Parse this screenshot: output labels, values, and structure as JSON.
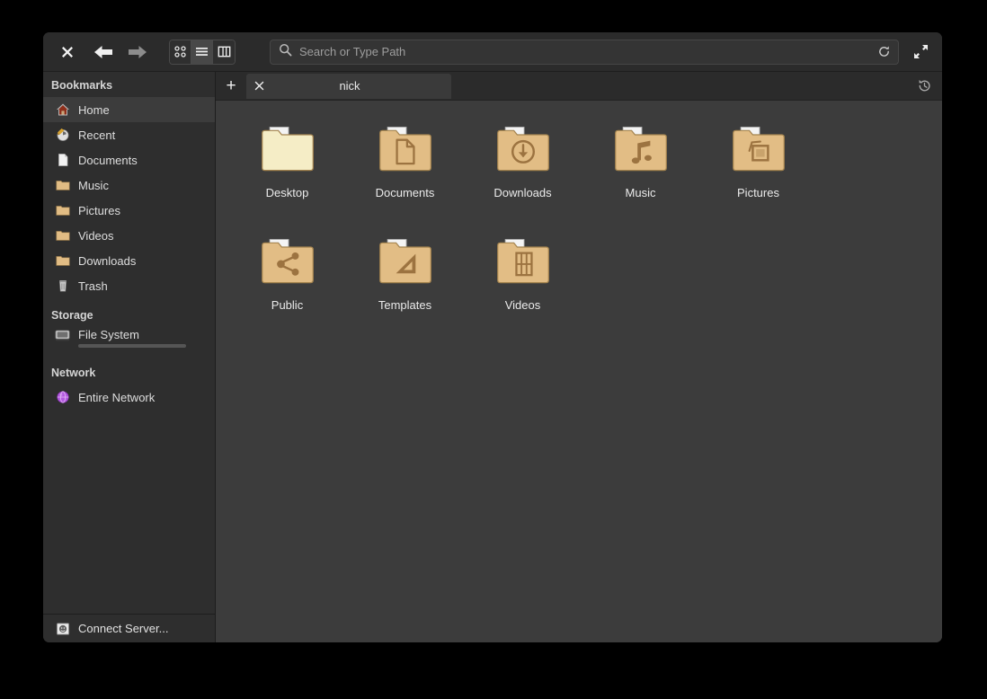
{
  "toolbar": {
    "close_label": "✕",
    "back_icon": "arrow-left-icon",
    "forward_icon": "arrow-right-icon",
    "view_modes": [
      {
        "name": "icon-view",
        "icon": "grid-dots-icon",
        "active": false
      },
      {
        "name": "list-view",
        "icon": "list-lines-icon",
        "active": true
      },
      {
        "name": "column-view",
        "icon": "columns-icon",
        "active": false
      }
    ],
    "search": {
      "placeholder": "Search or Type Path",
      "value": "",
      "icon": "search-icon",
      "reload_icon": "reload-icon"
    },
    "expand_icon": "fullscreen-icon"
  },
  "tabbar": {
    "new_tab_label": "+",
    "tabs": [
      {
        "title": "nick",
        "close_label": "✖",
        "active": true
      }
    ],
    "history_icon": "history-icon"
  },
  "sidebar": {
    "sections": [
      {
        "header": "Bookmarks",
        "items": [
          {
            "label": "Home",
            "icon": "home-icon",
            "selected": true
          },
          {
            "label": "Recent",
            "icon": "recent-icon",
            "selected": false
          },
          {
            "label": "Documents",
            "icon": "document-icon",
            "selected": false
          },
          {
            "label": "Music",
            "icon": "folder-icon",
            "selected": false
          },
          {
            "label": "Pictures",
            "icon": "folder-icon",
            "selected": false
          },
          {
            "label": "Videos",
            "icon": "folder-icon",
            "selected": false
          },
          {
            "label": "Downloads",
            "icon": "folder-icon",
            "selected": false
          },
          {
            "label": "Trash",
            "icon": "trash-icon",
            "selected": false
          }
        ]
      },
      {
        "header": "Storage",
        "items": [
          {
            "label": "File System",
            "icon": "drive-icon",
            "selected": false,
            "usage_percent": 12
          }
        ]
      },
      {
        "header": "Network",
        "items": [
          {
            "label": "Entire Network",
            "icon": "network-globe-icon",
            "selected": false
          }
        ]
      }
    ],
    "footer": {
      "label": "Connect Server...",
      "icon": "server-icon"
    }
  },
  "content": {
    "files": [
      {
        "name": "Desktop",
        "kind": "folder",
        "glyph": "plain-folder-icon",
        "tint": "#f5edc6"
      },
      {
        "name": "Documents",
        "kind": "folder",
        "glyph": "document-glyph",
        "tint": "#e2bd85"
      },
      {
        "name": "Downloads",
        "kind": "folder",
        "glyph": "download-glyph",
        "tint": "#e2bd85"
      },
      {
        "name": "Music",
        "kind": "folder",
        "glyph": "music-note-glyph",
        "tint": "#e2bd85"
      },
      {
        "name": "Pictures",
        "kind": "folder",
        "glyph": "picture-glyph",
        "tint": "#e2bd85"
      },
      {
        "name": "Public",
        "kind": "folder",
        "glyph": "share-glyph",
        "tint": "#e2bd85"
      },
      {
        "name": "Templates",
        "kind": "folder",
        "glyph": "template-glyph",
        "tint": "#e2bd85"
      },
      {
        "name": "Videos",
        "kind": "folder",
        "glyph": "film-glyph",
        "tint": "#e2bd85"
      }
    ]
  },
  "colors": {
    "window_bg": "#3c3c3c",
    "sidebar_bg": "#2e2e2e",
    "toolbar_bg": "#2b2b2b",
    "selection_bg": "#3c3c3c",
    "folder_tan": "#e2bd85",
    "folder_cream": "#f5edc6",
    "glyph_brown": "#9c7340",
    "text": "#e6e6e6"
  }
}
